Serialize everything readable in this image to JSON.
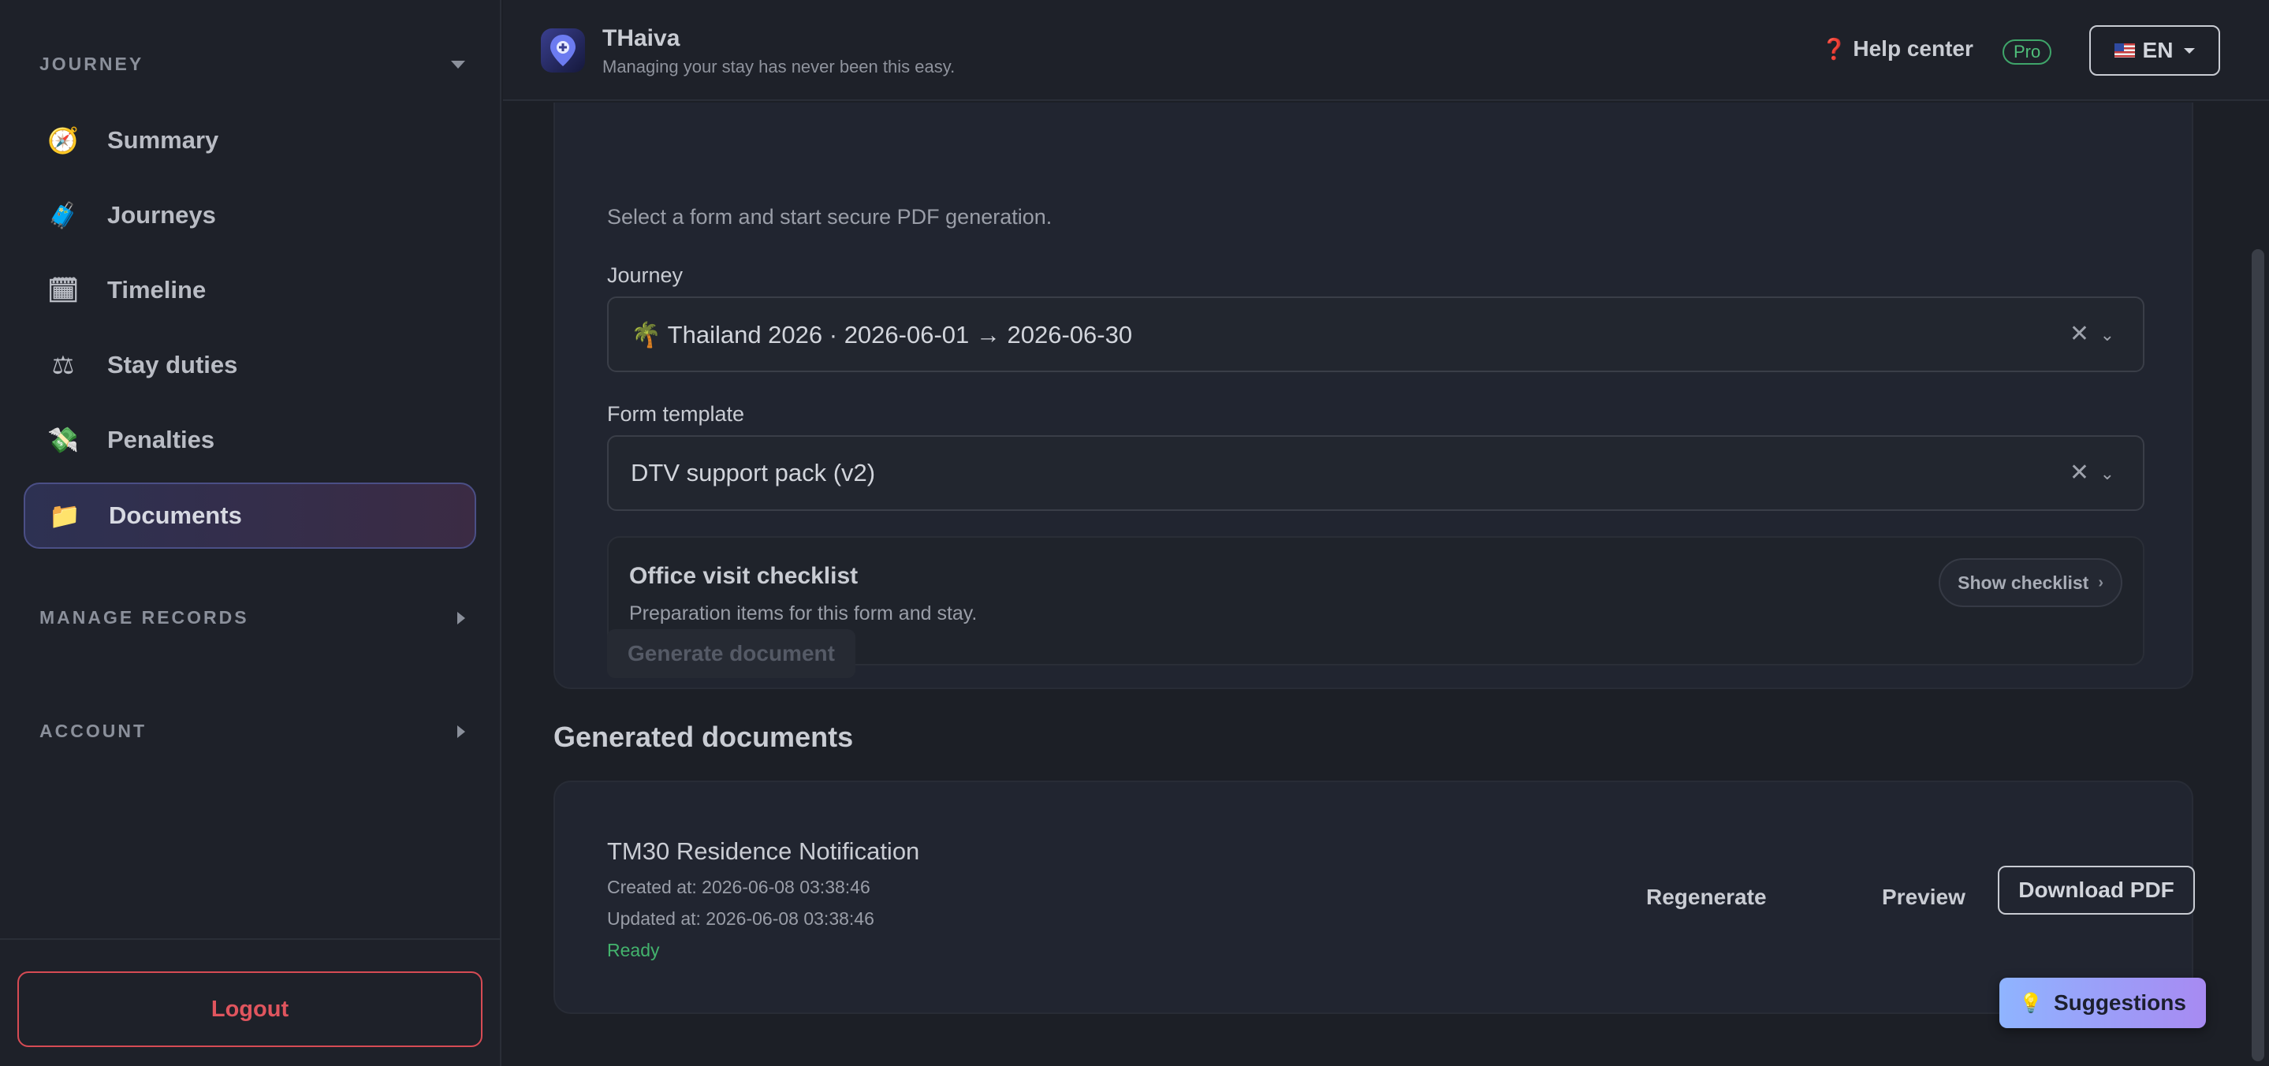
{
  "sidebar": {
    "sections": {
      "journey": "JOURNEY",
      "manage_records": "MANAGE RECORDS",
      "account": "ACCOUNT"
    },
    "items": [
      {
        "label": "Summary",
        "icon": "compass-icon",
        "glyph": "🧭"
      },
      {
        "label": "Journeys",
        "icon": "luggage-icon",
        "glyph": "🧳"
      },
      {
        "label": "Timeline",
        "icon": "calendar-icon",
        "glyph": "🗓"
      },
      {
        "label": "Stay duties",
        "icon": "scales-icon",
        "glyph": "⚖"
      },
      {
        "label": "Penalties",
        "icon": "money-wings-icon",
        "glyph": "💸"
      },
      {
        "label": "Documents",
        "icon": "folder-icon",
        "glyph": "📁",
        "active": true
      }
    ],
    "logout_label": "Logout"
  },
  "header": {
    "title": "THaiva",
    "subtitle": "Managing your stay has never been this easy.",
    "help_label": "Help center",
    "help_glyph": "❓",
    "pro_badge": "Pro",
    "language": "EN"
  },
  "form": {
    "hint": "Select a form and start secure PDF generation.",
    "journey_label": "Journey",
    "journey_value": "🌴 Thailand 2026 · 2026-06-01 → 2026-06-30",
    "template_label": "Form template",
    "template_value": "DTV support pack (v2)",
    "clear_glyph": "✕",
    "chevron_glyph": "⌄",
    "checklist": {
      "title": "Office visit checklist",
      "subtitle": "Preparation items for this form and stay.",
      "button": "Show checklist",
      "button_arrow": "›"
    },
    "generate_label": "Generate document"
  },
  "generated": {
    "title": "Generated documents",
    "documents": [
      {
        "name": "TM30 Residence Notification",
        "created": "Created at: 2026-06-08 03:38:46",
        "updated": "Updated at: 2026-06-08 03:38:46",
        "status": "Ready",
        "regenerate": "Regenerate",
        "preview": "Preview",
        "download": "Download PDF"
      }
    ]
  },
  "suggestions": {
    "label": "Suggestions",
    "glyph": "💡"
  },
  "colors": {
    "background": "#1c1f26",
    "accent_logout": "#e0555e",
    "status_ready": "#43b36d",
    "pro_green": "#4fbf7a"
  }
}
